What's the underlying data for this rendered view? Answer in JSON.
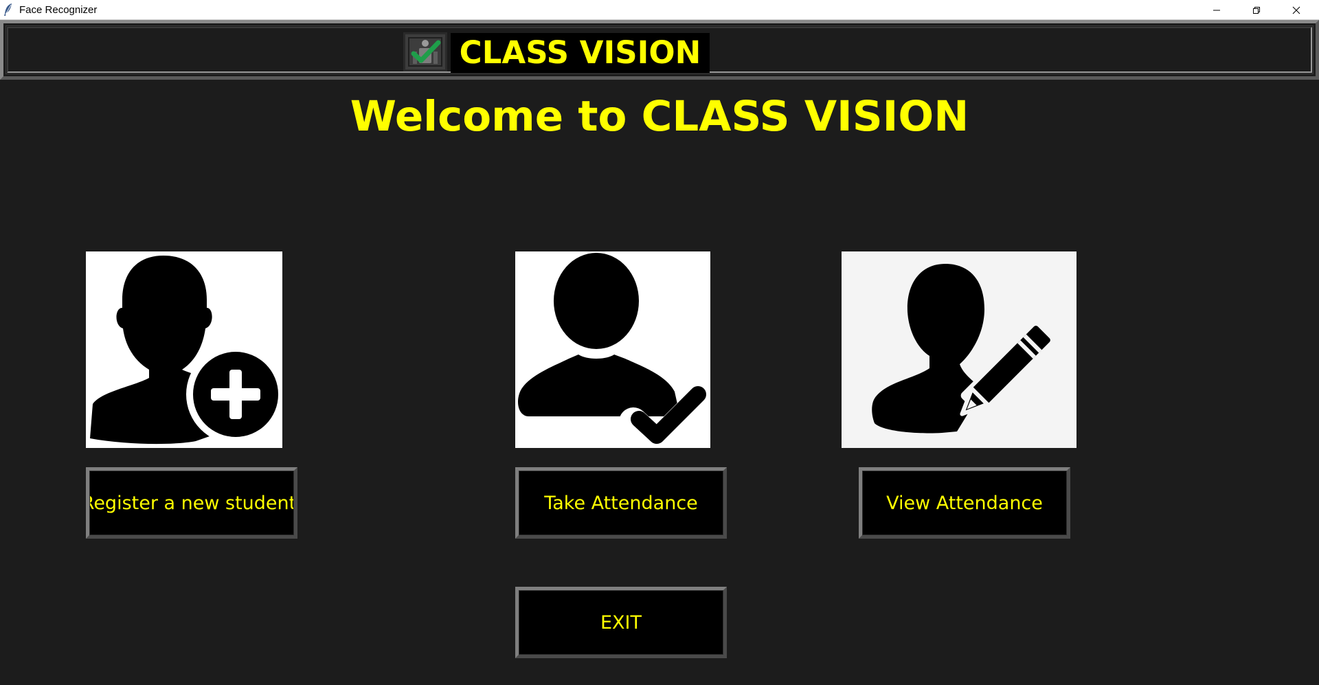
{
  "window": {
    "title": "Face Recognizer",
    "controls": [
      "minimize",
      "restore",
      "close"
    ]
  },
  "header": {
    "title": "CLASS VISION",
    "logo_icon": "attendance-check-icon",
    "title_color": "#ffff00"
  },
  "welcome": {
    "text": "Welcome to CLASS VISION"
  },
  "tiles": [
    {
      "icon": "add-user-icon",
      "button_label": "Register a new student"
    },
    {
      "icon": "user-check-icon",
      "button_label": "Take Attendance"
    },
    {
      "icon": "user-edit-icon",
      "button_label": "View Attendance"
    }
  ],
  "exit": {
    "label": "EXIT"
  },
  "colors": {
    "background": "#1c1c1c",
    "accent_text": "#ffff00",
    "button_bg": "#000000",
    "check_green": "#1f9e4a"
  }
}
